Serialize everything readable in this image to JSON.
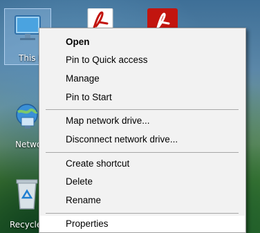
{
  "desktop": {
    "icons": [
      {
        "label": "This PC"
      },
      {
        "label": "Network"
      },
      {
        "label": "Recycle Bin"
      }
    ]
  },
  "context_menu": {
    "items": [
      {
        "label": "Open",
        "default": true
      },
      {
        "label": "Pin to Quick access"
      },
      {
        "label": "Manage"
      },
      {
        "label": "Pin to Start"
      },
      {
        "label": "Map network drive..."
      },
      {
        "label": "Disconnect network drive..."
      },
      {
        "label": "Create shortcut"
      },
      {
        "label": "Delete"
      },
      {
        "label": "Rename"
      },
      {
        "label": "Properties",
        "highlighted": true
      }
    ]
  },
  "colors": {
    "menu_background": "#f2f2f2",
    "menu_border": "#a0a0a0",
    "separator": "#a7a7a7",
    "pdf_red": "#c2150f"
  }
}
